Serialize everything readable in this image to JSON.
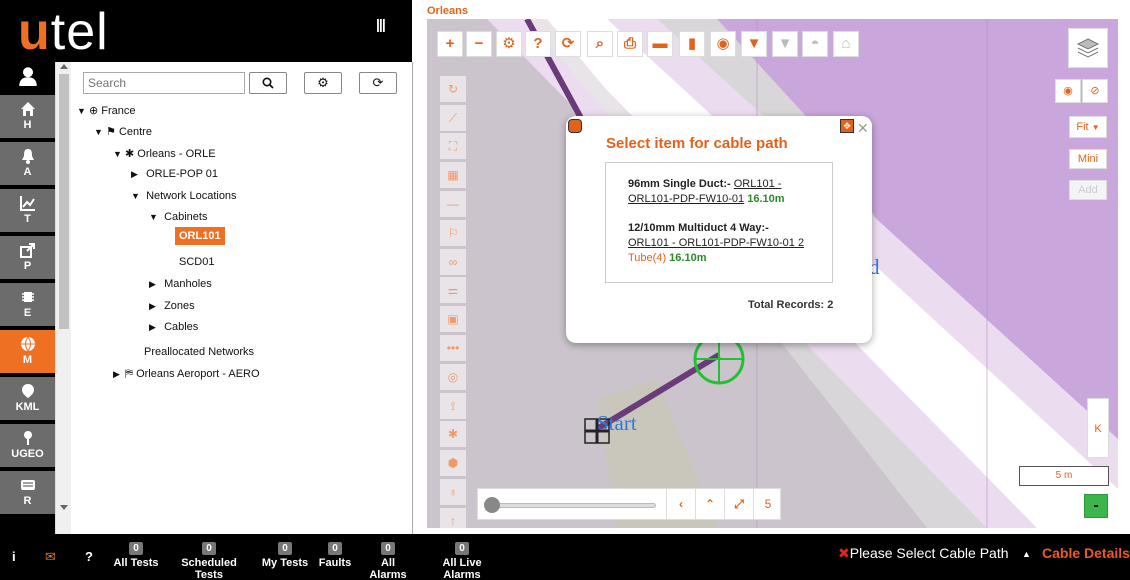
{
  "logo": {
    "u": "u",
    "tel": "tel"
  },
  "rail": {
    "items": [
      {
        "label": "H",
        "icon": "home-icon"
      },
      {
        "label": "A",
        "icon": "bell-icon"
      },
      {
        "label": "T",
        "icon": "chart-icon"
      },
      {
        "label": "P",
        "icon": "share-icon"
      },
      {
        "label": "E",
        "icon": "chip-icon"
      },
      {
        "label": "M",
        "icon": "globe-icon",
        "active": true
      },
      {
        "label": "KML",
        "icon": "map-marker-icon"
      },
      {
        "label": "UGEO",
        "icon": "pin-icon"
      },
      {
        "label": "R",
        "icon": "report-icon"
      }
    ]
  },
  "tree": {
    "search_placeholder": "Search",
    "nodes": {
      "france": "France",
      "centre": "Centre",
      "orleans": "Orleans - ORLE",
      "pop": "ORLE-POP 01",
      "network_locations": "Network Locations",
      "cabinets": "Cabinets",
      "orl101": "ORL101",
      "scd01": "SCD01",
      "manholes": "Manholes",
      "zones": "Zones",
      "cables": "Cables",
      "preallocated": "Preallocated Networks",
      "aeroport": "Orleans Aeroport - AERO"
    }
  },
  "map": {
    "title": "Orleans",
    "start_label": "Start",
    "end_label_partial": "d",
    "right_controls": {
      "fit": "Fit",
      "mini": "Mini",
      "add": "Add",
      "k": "K"
    },
    "scale": "5 m",
    "zoom_level": "5"
  },
  "popup": {
    "title": "Select item for cable path",
    "records": [
      {
        "type": "96mm Single Duct:-",
        "link": "ORL101 - ORL101-PDP-FW10-01",
        "length": "16.10m"
      },
      {
        "type": "12/10mm Multiduct 4 Way:-",
        "link": "ORL101 - ORL101-PDP-FW10-01 2",
        "tube": "Tube(4)",
        "length": "16.10m"
      }
    ],
    "total": "Total Records: 2"
  },
  "bottom": {
    "stats": [
      {
        "count": "0",
        "label": "All Tests"
      },
      {
        "count": "0",
        "label": "Scheduled Tests"
      },
      {
        "count": "0",
        "label": "My Tests"
      },
      {
        "count": "0",
        "label": "Faults"
      },
      {
        "count": "0",
        "label": "All Alarms"
      },
      {
        "count": "0",
        "label": "All Live Alarms"
      }
    ],
    "status": "Please Select Cable Path",
    "details": "Cable Details"
  },
  "colors": {
    "accent": "#ee7023",
    "map_purple": "#c9a6dc",
    "cable": "#6b3a7a",
    "marker": "#22c033"
  }
}
